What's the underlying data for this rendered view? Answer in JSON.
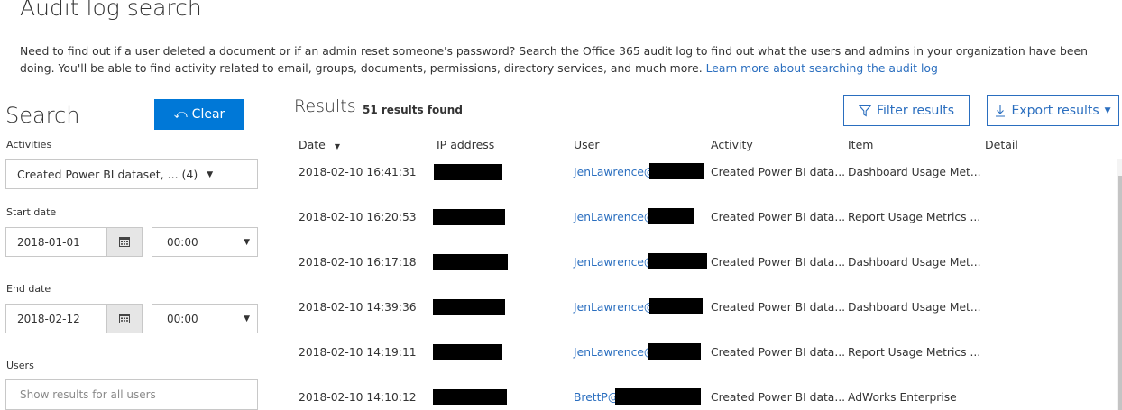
{
  "page": {
    "title": "Audit log search",
    "intro_text": "Need to find out if a user deleted a document or if an admin reset someone's password? Search the Office 365 audit log to find out what the users and admins in your organization have been doing. You'll be able to find activity related to email, groups, documents, permissions, directory services, and much more. ",
    "learn_more_link": "Learn more about searching the audit log"
  },
  "search": {
    "heading": "Search",
    "clear_label": "Clear",
    "activities_label": "Activities",
    "activities_value": "Created Power BI dataset, ... (4)",
    "start_date_label": "Start date",
    "start_date": "2018-01-01",
    "start_time": "00:00",
    "end_date_label": "End date",
    "end_date": "2018-02-12",
    "end_time": "00:00",
    "users_label": "Users",
    "users_placeholder": "Show results for all users"
  },
  "results": {
    "heading": "Results",
    "count": "51 results found",
    "filter_label": "Filter results",
    "export_label": "Export results",
    "columns": [
      "Date",
      "IP address",
      "User",
      "Activity",
      "Item",
      "Detail"
    ],
    "rows": [
      {
        "date": "2018-02-10 16:41:31",
        "user": "JenLawrence@",
        "activity": "Created Power BI data...",
        "item": "Dashboard Usage Met..."
      },
      {
        "date": "2018-02-10 16:20:53",
        "user": "JenLawrence@",
        "activity": "Created Power BI data...",
        "item": "Report Usage Metrics ..."
      },
      {
        "date": "2018-02-10 16:17:18",
        "user": "JenLawrence@",
        "activity": "Created Power BI data...",
        "item": "Dashboard Usage Met..."
      },
      {
        "date": "2018-02-10 14:39:36",
        "user": "JenLawrence@",
        "activity": "Created Power BI data...",
        "item": "Dashboard Usage Met..."
      },
      {
        "date": "2018-02-10 14:19:11",
        "user": "JenLawrence@",
        "activity": "Created Power BI data...",
        "item": "Report Usage Metrics ..."
      },
      {
        "date": "2018-02-10 14:10:12",
        "user": "BrettP@",
        "activity": "Created Power BI data...",
        "item": "AdWorks Enterprise"
      }
    ]
  },
  "icons": {
    "clear": "undo-icon",
    "calendar": "calendar-icon",
    "filter": "filter-icon",
    "export": "download-icon",
    "sort": "sort-down-icon"
  },
  "colors": {
    "accent": "#0078d7",
    "link": "#2a6ebf",
    "redaction": "#000000"
  }
}
